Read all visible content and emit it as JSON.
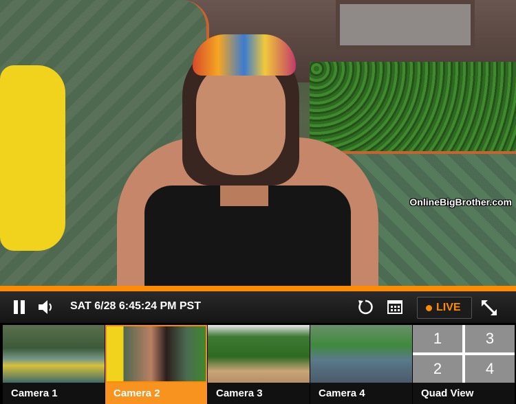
{
  "player": {
    "watermark": "OnlineBigBrother.com",
    "timestamp": "SAT 6/28 6:45:24 PM PST",
    "live_label": "LIVE",
    "progress_fraction": 1.0,
    "accent_color": "#ff8c00"
  },
  "icons": [
    "pause-icon",
    "volume-icon",
    "replay-icon",
    "calendar-icon",
    "expand-icon"
  ],
  "cameras": [
    {
      "label": "Camera 1",
      "active": false
    },
    {
      "label": "Camera 2",
      "active": true
    },
    {
      "label": "Camera 3",
      "active": false
    },
    {
      "label": "Camera 4",
      "active": false
    },
    {
      "label": "Quad View",
      "active": false
    }
  ],
  "quad": [
    "1",
    "3",
    "2",
    "4"
  ]
}
